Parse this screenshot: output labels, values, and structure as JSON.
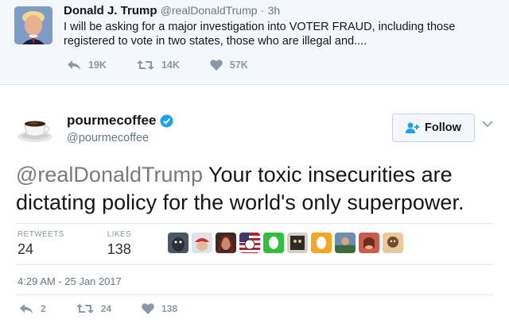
{
  "quoted_tweet": {
    "name": "Donald J. Trump",
    "handle": "@realDonaldTrump",
    "separator": "·",
    "time": "3h",
    "text": "I will be asking for a major investigation into VOTER FRAUD, including those registered to vote in two states, those who are illegal and....",
    "reply_count": "19K",
    "retweet_count": "14K",
    "like_count": "57K"
  },
  "main_tweet": {
    "name": "pourmecoffee",
    "handle": "@pourmecoffee",
    "follow_label": "Follow",
    "mention": "@realDonaldTrump",
    "text_rest": " Your toxic insecurities are dictating policy for the world's only superpower.",
    "retweets_label": "RETWEETS",
    "retweets_value": "24",
    "likes_label": "LIKES",
    "likes_value": "138",
    "timestamp": "4:29 AM - 25 Jan 2017",
    "reply_count": "2",
    "retweet_count": "24",
    "like_count": "138"
  },
  "colors": {
    "verified": "#1da1f2",
    "icon_gray": "#8899a6",
    "link_blue": "#1da1f2"
  }
}
